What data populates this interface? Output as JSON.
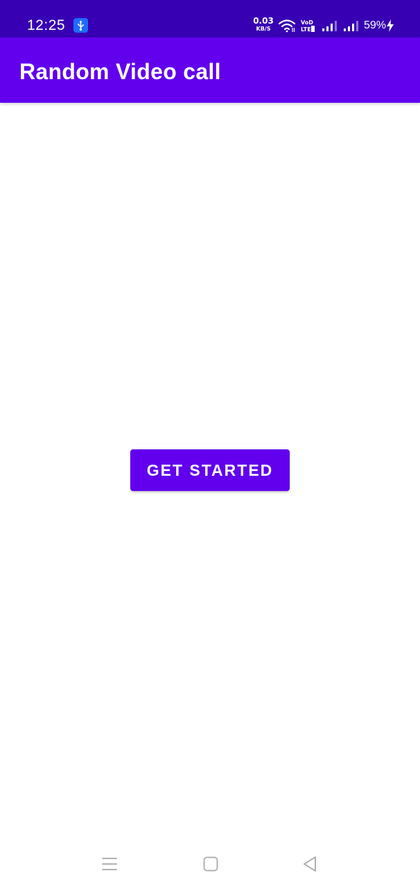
{
  "status_bar": {
    "time": "12:25",
    "net_speed_value": "0.03",
    "net_speed_unit": "KB/S",
    "battery_percent": "59%",
    "icons": [
      "usb-icon",
      "wifi-icon",
      "volte-icon",
      "signal-icon",
      "signal-icon",
      "charging-icon"
    ]
  },
  "app_bar": {
    "title": "Random Video call"
  },
  "main": {
    "get_started_label": "GET STARTED"
  },
  "nav_bar": {
    "icons": [
      "menu-icon",
      "home-icon",
      "back-icon"
    ]
  },
  "colors": {
    "status_bar": "#3700b3",
    "primary": "#6200ee",
    "background": "#ffffff"
  }
}
